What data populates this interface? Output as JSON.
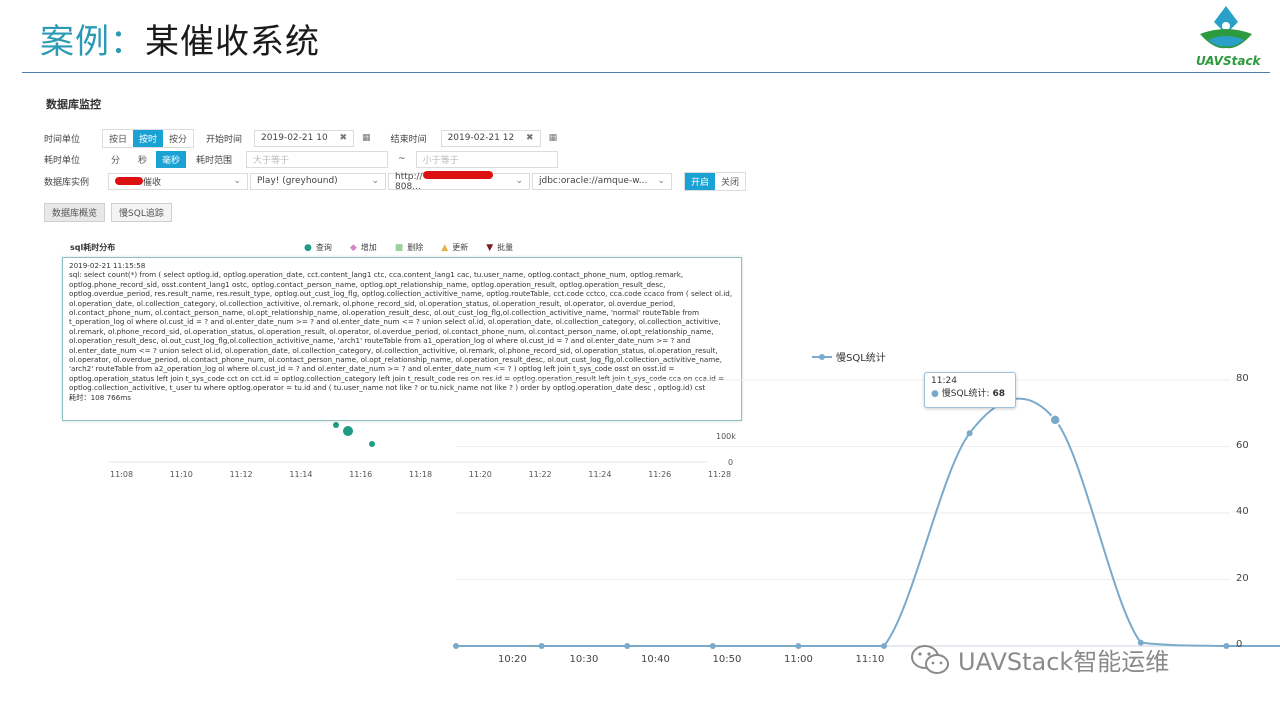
{
  "slide": {
    "title_prefix": "案例：",
    "title_main": "某催收系统",
    "logo_text": "UAVStack",
    "watermark": "UAVStack智能运维"
  },
  "panel": {
    "title": "数据库监控",
    "time_unit": {
      "label": "时间单位",
      "options": [
        "按日",
        "按时",
        "按分"
      ],
      "selected": "按时"
    },
    "start_time": {
      "label": "开始时间",
      "value": "2019-02-21 10"
    },
    "end_time": {
      "label": "结束时间",
      "value": "2019-02-21 12"
    },
    "cost_unit": {
      "label": "耗时单位",
      "options": [
        "分",
        "秒",
        "毫秒"
      ],
      "selected": "毫秒"
    },
    "cost_range": {
      "label": "耗时范围",
      "min_placeholder": "大于等于",
      "sep": "~",
      "max_placeholder": "小于等于"
    },
    "db_instance": {
      "label": "数据库实例",
      "instance_suffix": "催收",
      "app": "Play! (greyhound)",
      "url_prefix": "http://",
      "url_suffix": "808...",
      "jdbc": "jdbc:oracle://amque-w...",
      "on_label": "开启",
      "off_label": "关闭"
    },
    "tabs": [
      "数据库概览",
      "慢SQL追踪"
    ],
    "sql_chart": {
      "title": "sql耗时分布",
      "legend": [
        {
          "name": "查询",
          "symbol": "●",
          "color": "#1f9b86"
        },
        {
          "name": "增加",
          "symbol": "◆",
          "color": "#d884c6"
        },
        {
          "name": "删除",
          "symbol": "■",
          "color": "#9bd29b"
        },
        {
          "name": "更新",
          "symbol": "▲",
          "color": "#e9b04a"
        },
        {
          "name": "批量",
          "symbol": "▼",
          "color": "#7a1d1d"
        }
      ],
      "tooltip": {
        "time": "2019-02-21 11:15:58",
        "sql": "sql: select count(*) from ( select optlog.id, optlog.operation_date, cct.content_lang1 ctc, cca.content_lang1 cac, tu.user_name, optlog.contact_phone_num, optlog.remark, optlog.phone_record_sid, osst.content_lang1 ostc, optlog.contact_person_name, optlog.opt_relationship_name, optlog.operation_result, optlog.operation_result_desc, optlog.overdue_period, res.result_name, res.result_type, optlog.out_cust_log_flg, optlog.collection_activitive_name, optlog.routeTable, cct.code cctco, cca.code ccaco from ( select ol.id, ol.operation_date, ol.collection_category, ol.collection_activitive, ol.remark, ol.phone_record_sid, ol.operation_status, ol.operation_result, ol.operator, ol.overdue_period, ol.contact_phone_num, ol.contact_person_name, ol.opt_relationship_name, ol.operation_result_desc, ol.out_cust_log_flg,ol.collection_activitive_name, 'normal' routeTable from t_operation_log ol where ol.cust_id = ? and ol.enter_date_num >= ? and ol.enter_date_num <= ? union select ol.id, ol.operation_date, ol.collection_category, ol.collection_activitive, ol.remark, ol.phone_record_sid, ol.operation_status, ol.operation_result, ol.operator, ol.overdue_period, ol.contact_phone_num, ol.contact_person_name, ol.opt_relationship_name, ol.operation_result_desc, ol.out_cust_log_flg,ol.collection_activitive_name, 'arch1' routeTable from a1_operation_log ol where ol.cust_id = ? and ol.enter_date_num >= ? and ol.enter_date_num <= ? union select ol.id, ol.operation_date, ol.collection_category, ol.collection_activitive, ol.remark, ol.phone_record_sid, ol.operation_status, ol.operation_result, ol.operator, ol.overdue_period, ol.contact_phone_num, ol.contact_person_name, ol.opt_relationship_name, ol.operation_result_desc, ol.out_cust_log_flg,ol.collection_activitive_name, 'arch2' routeTable from a2_operation_log ol where ol.cust_id = ? and ol.enter_date_num >= ? and ol.enter_date_num <= ? ) optlog left join t_sys_code osst on osst.id = optlog.operation_status left join t_sys_code cct on cct.id = optlog.collection_category left join t_result_code res on res.id = optlog.operation_result left join t_sys_code cca on cca.id = optlog.collection_activitive, t_user tu where optlog.operator = tu.id and ( tu.user_name not like ? or tu.nick_name not like ? ) order by optlog.operation_date desc , optlog.id) cst",
        "cost": "耗时：108 766ms"
      },
      "x_ticks": [
        "11:08",
        "11:10",
        "11:12",
        "11:14",
        "11:16",
        "11:18",
        "11:20",
        "11:22",
        "11:24",
        "11:26",
        "11:28"
      ],
      "y_ticks": [
        "100k",
        "0"
      ]
    }
  },
  "chart_data": {
    "type": "line",
    "series": [
      {
        "name": "慢SQL统计",
        "color": "#7aaacb"
      }
    ],
    "x": [
      "10:14",
      "10:24",
      "10:34",
      "10:44",
      "10:54",
      "11:04",
      "11:14",
      "11:24",
      "11:34",
      "11:44",
      "11:54"
    ],
    "values": [
      0,
      0,
      0,
      0,
      0,
      0,
      64,
      68,
      1,
      0,
      0
    ],
    "x_tick_labels": [
      "10:20",
      "10:30",
      "10:40",
      "10:50",
      "11:00",
      "11:10"
    ],
    "y_tick_labels": [
      "80",
      "60",
      "40",
      "20",
      "0"
    ],
    "ylim": [
      0,
      80
    ],
    "tooltip": {
      "time": "11:24",
      "label": "慢SQL统计",
      "value": "68"
    }
  }
}
